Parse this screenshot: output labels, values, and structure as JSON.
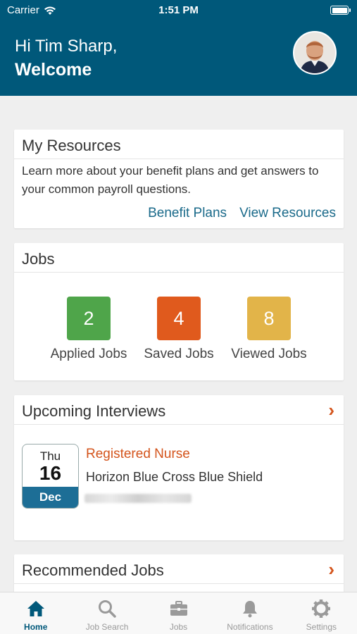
{
  "status_bar": {
    "carrier": "Carrier",
    "time": "1:51 PM"
  },
  "header": {
    "greeting": "Hi Tim Sharp,",
    "welcome": "Welcome"
  },
  "resources": {
    "title": "My Resources",
    "description": "Learn more about your benefit plans and get answers to your common payroll questions.",
    "links": [
      "Benefit Plans",
      "View Resources"
    ]
  },
  "jobs": {
    "title": "Jobs",
    "tiles": [
      {
        "count": "2",
        "label": "Applied Jobs",
        "color": "#4fa54a"
      },
      {
        "count": "4",
        "label": "Saved Jobs",
        "color": "#e05a1d"
      },
      {
        "count": "8",
        "label": "Viewed Jobs",
        "color": "#e2b449"
      }
    ]
  },
  "interviews": {
    "title": "Upcoming Interviews",
    "item": {
      "day_of_week": "Thu",
      "day": "16",
      "month": "Dec",
      "job_title": "Registered Nurse",
      "company": "Horizon Blue Cross Blue Shield"
    }
  },
  "recommended": {
    "title": "Recommended Jobs"
  },
  "tabbar": {
    "active": "Home",
    "tabs": [
      {
        "label": "Home",
        "icon": "home-icon"
      },
      {
        "label": "Job Search",
        "icon": "search-icon"
      },
      {
        "label": "Jobs",
        "icon": "briefcase-icon"
      },
      {
        "label": "Notifications",
        "icon": "bell-icon"
      },
      {
        "label": "Settings",
        "icon": "gear-icon"
      }
    ]
  },
  "colors": {
    "primary": "#00587a",
    "accent": "#d4541c",
    "link": "#1a6a8a"
  }
}
